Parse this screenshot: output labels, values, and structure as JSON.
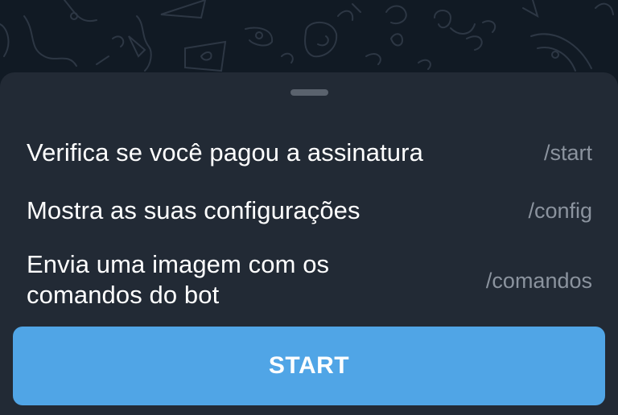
{
  "commands": [
    {
      "description": "Verifica se você pagou a assinatura",
      "command": "/start"
    },
    {
      "description": "Mostra as suas configurações",
      "command": "/config"
    },
    {
      "description": "Envia uma imagem com os\ncomandos do bot",
      "command": "/comandos"
    }
  ],
  "start_button": {
    "label": "START"
  },
  "colors": {
    "background": "#111a24",
    "sheet": "#222a35",
    "button": "#50a5e6",
    "text": "#ffffff",
    "muted_text": "#8b939e"
  }
}
